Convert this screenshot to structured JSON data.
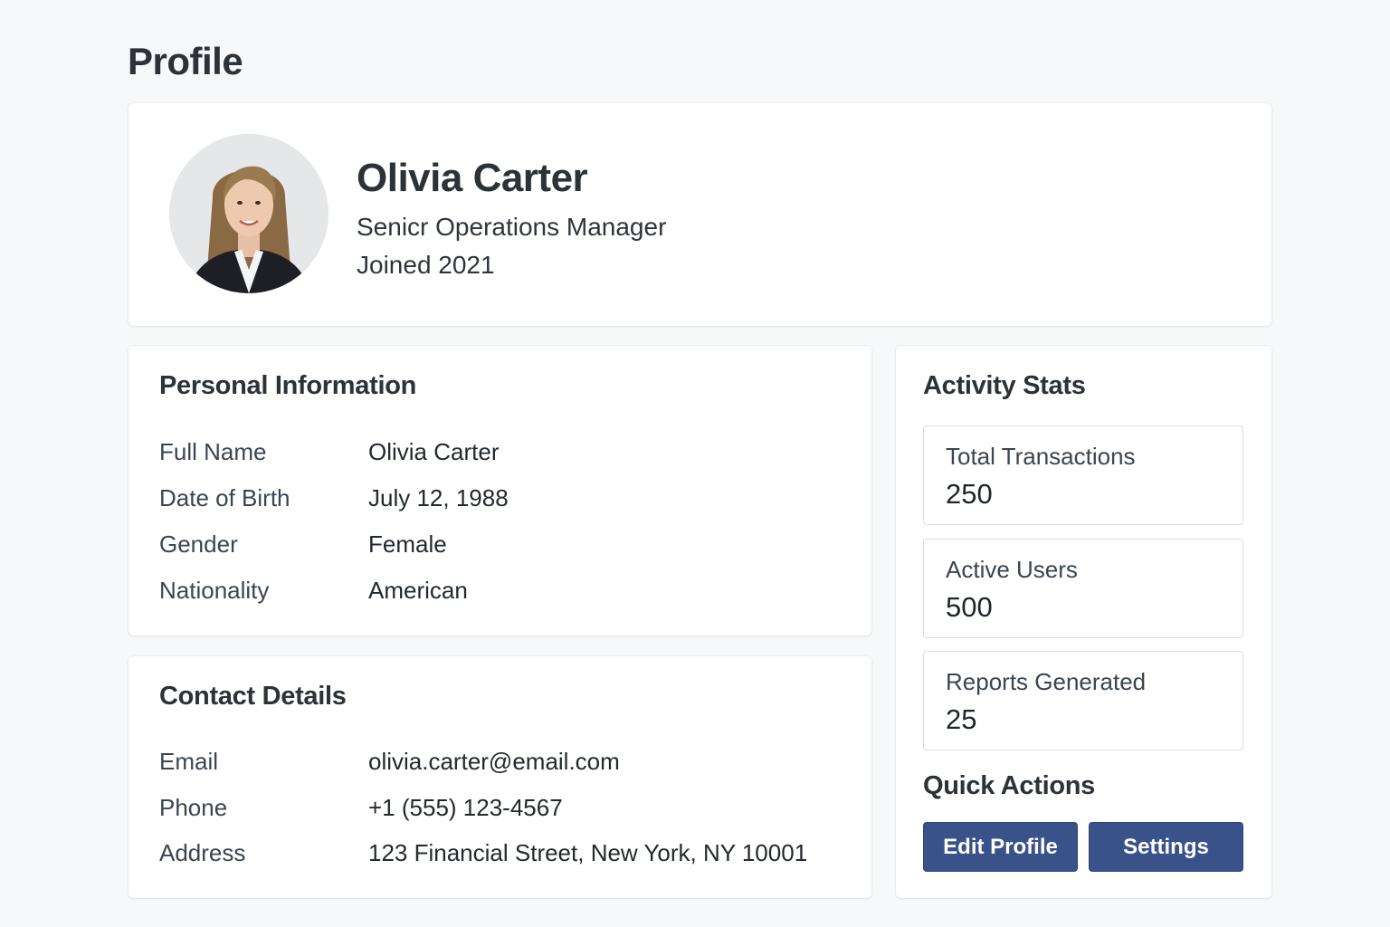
{
  "page": {
    "title": "Profile"
  },
  "profile": {
    "name": "Olivia Carter",
    "job_title": "Senicr Operations Manager",
    "joined": "Joined 2021",
    "avatar": "profile-photo"
  },
  "personal_info": {
    "title": "Personal Information",
    "rows": [
      {
        "label": "Full Name",
        "value": "Olivia Carter"
      },
      {
        "label": "Date of Birth",
        "value": "July 12, 1988"
      },
      {
        "label": "Gender",
        "value": "Female"
      },
      {
        "label": "Nationality",
        "value": "American"
      }
    ]
  },
  "contact": {
    "title": "Contact Details",
    "rows": [
      {
        "label": "Email",
        "value": "olivia.carter@email.com"
      },
      {
        "label": "Phone",
        "value": "+1 (555) 123-4567"
      },
      {
        "label": "Address",
        "value": "123 Financial Street, New York, NY 10001"
      }
    ]
  },
  "activity": {
    "title": "Activity Stats",
    "stats": [
      {
        "label": "Total Transactions",
        "value": "250"
      },
      {
        "label": "Active Users",
        "value": "500"
      },
      {
        "label": "Reports Generated",
        "value": "25"
      }
    ]
  },
  "quick_actions": {
    "title": "Quick Actions",
    "edit_label": "Edit Profile",
    "settings_label": "Settings"
  },
  "colors": {
    "background": "#f7f8fa",
    "card": "#ffffff",
    "button": "#3a528a",
    "text": "#2c3238"
  }
}
